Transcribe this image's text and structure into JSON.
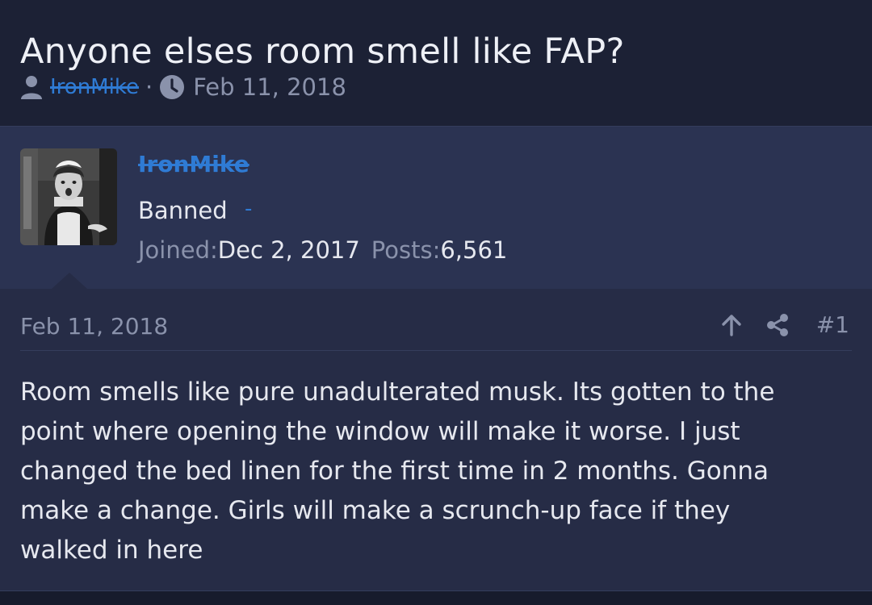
{
  "thread": {
    "title": "Anyone elses room smell like FAP?",
    "author": "IronMike",
    "separator": "·",
    "date": "Feb 11, 2018"
  },
  "user": {
    "name": "IronMike",
    "title": "Banned",
    "title_suffix": "-",
    "joined_label": "Joined:",
    "joined_value": "Dec 2, 2017",
    "posts_label": "Posts:",
    "posts_value": "6,561"
  },
  "post": {
    "date": "Feb 11, 2018",
    "number": "#1",
    "body_lines": [
      "Room smells like pure unadulterated musk. Its gotten to the",
      "point where opening the window will make it worse.  I just",
      "changed the bed linen for the first time in 2 months.  Gonna",
      "make a change. Girls will make a scrunch-up face if they",
      "walked in here"
    ]
  },
  "icons": {
    "author": "user-icon",
    "date": "clock-icon",
    "upvote": "arrow-up-icon",
    "share": "share-icon"
  },
  "colors": {
    "background": "#1c2135",
    "user_block": "#2b3352",
    "post_body": "#262c46",
    "link_blue": "#2f7bd4",
    "muted_text": "#8a92ab"
  }
}
